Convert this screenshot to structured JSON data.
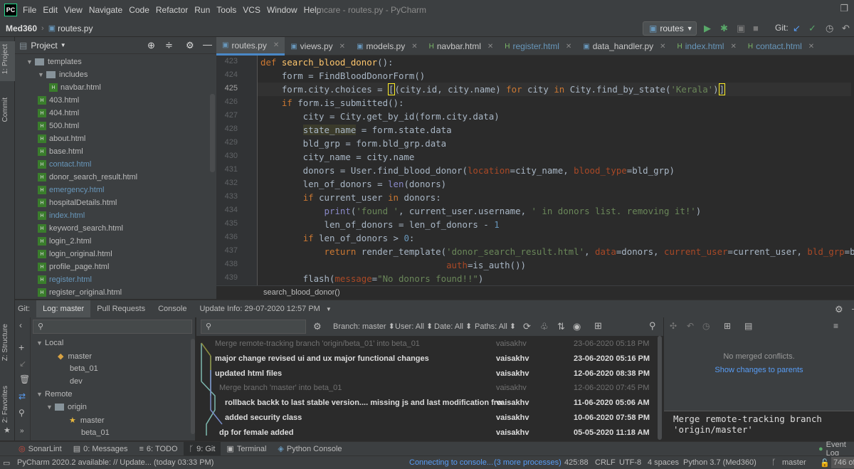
{
  "app": {
    "logo": "PC",
    "window_title": "mcare - routes.py - PyCharm",
    "menu": [
      "File",
      "Edit",
      "View",
      "Navigate",
      "Code",
      "Refactor",
      "Run",
      "Tools",
      "VCS",
      "Window",
      "Help"
    ]
  },
  "navbar": {
    "project": "Med360",
    "file": "routes.py",
    "run_config": "routes",
    "git_label": "Git:"
  },
  "left_strip": {
    "project_tab": "1: Project",
    "commit_tab": "Commit",
    "structure_tab": "Z: Structure",
    "favorites_tab": "2: Favorites"
  },
  "project": {
    "title": "Project",
    "tree": [
      {
        "label": "templates",
        "type": "folder",
        "depth": 0,
        "open": true
      },
      {
        "label": "includes",
        "type": "folder",
        "depth": 1,
        "open": true
      },
      {
        "label": "navbar.html",
        "type": "html",
        "depth": 2
      },
      {
        "label": "403.html",
        "type": "html",
        "depth": 1
      },
      {
        "label": "404.html",
        "type": "html",
        "depth": 1
      },
      {
        "label": "500.html",
        "type": "html",
        "depth": 1
      },
      {
        "label": "about.html",
        "type": "html",
        "depth": 1
      },
      {
        "label": "base.html",
        "type": "html",
        "depth": 1
      },
      {
        "label": "contact.html",
        "type": "html",
        "depth": 1,
        "modified": true
      },
      {
        "label": "donor_search_result.html",
        "type": "html",
        "depth": 1
      },
      {
        "label": "emergency.html",
        "type": "html",
        "depth": 1,
        "modified": true
      },
      {
        "label": "hospitalDetails.html",
        "type": "html",
        "depth": 1
      },
      {
        "label": "index.html",
        "type": "html",
        "depth": 1,
        "modified": true
      },
      {
        "label": "keyword_search.html",
        "type": "html",
        "depth": 1
      },
      {
        "label": "login_2.html",
        "type": "html",
        "depth": 1
      },
      {
        "label": "login_original.html",
        "type": "html",
        "depth": 1
      },
      {
        "label": "profile_page.html",
        "type": "html",
        "depth": 1
      },
      {
        "label": "register.html",
        "type": "html",
        "depth": 1,
        "modified": true
      },
      {
        "label": "register_original.html",
        "type": "html",
        "depth": 1
      }
    ]
  },
  "editor": {
    "tabs": [
      {
        "label": "routes.py",
        "active": true,
        "modified": false
      },
      {
        "label": "views.py",
        "active": false,
        "modified": false
      },
      {
        "label": "models.py",
        "active": false,
        "modified": false
      },
      {
        "label": "navbar.html",
        "active": false,
        "modified": false
      },
      {
        "label": "register.html",
        "active": false,
        "modified": true
      },
      {
        "label": "data_handler.py",
        "active": false,
        "modified": false
      },
      {
        "label": "index.html",
        "active": false,
        "modified": true
      },
      {
        "label": "contact.html",
        "active": false,
        "modified": true
      }
    ],
    "line_numbers": [
      "423",
      "424",
      "425",
      "426",
      "427",
      "428",
      "429",
      "430",
      "431",
      "432",
      "433",
      "434",
      "435",
      "436",
      "437",
      "438",
      "439"
    ],
    "current_line": "425",
    "breadcrumb": "search_blood_donor()"
  },
  "git": {
    "label": "Git:",
    "tabs": [
      "Log: master",
      "Pull Requests",
      "Console",
      "Update Info: 29-07-2020 12:57 PM"
    ],
    "branches": {
      "local_label": "Local",
      "local": [
        "master",
        "beta_01",
        "dev"
      ],
      "remote_label": "Remote",
      "origin": "origin",
      "remote": [
        "master",
        "beta_01"
      ]
    },
    "filters": {
      "branch": "Branch: master",
      "user": "User: All",
      "date": "Date: All",
      "paths": "Paths: All"
    },
    "commits": [
      {
        "message": "Merge remote-tracking branch 'origin/beta_01' into beta_01",
        "author": "vaisakhv",
        "date": "23-06-2020 05:18 PM",
        "dim": true
      },
      {
        "message": "major change revised ui and ux major functional changes",
        "author": "vaisakhv",
        "date": "23-06-2020 05:16 PM",
        "dim": false
      },
      {
        "message": "updated html files",
        "author": "vaisakhv",
        "date": "12-06-2020 08:38 PM",
        "dim": false
      },
      {
        "message": "Merge branch 'master' into beta_01",
        "author": "vaisakhv",
        "date": "12-06-2020 07:45 PM",
        "dim": true
      },
      {
        "message": "rollback backk to last stable version.... missing js and last modification from f",
        "author": "vaisakhv",
        "date": "11-06-2020 05:06 AM",
        "dim": false
      },
      {
        "message": "added security class",
        "author": "vaisakhv",
        "date": "10-06-2020 07:58 PM",
        "dim": false
      },
      {
        "message": "dp for female added",
        "author": "vaisakhv",
        "date": "05-05-2020 11:18 AM",
        "dim": false
      }
    ],
    "no_conflicts": "No merged conflicts.",
    "show_changes": "Show changes to parents",
    "commit_detail": "Merge remote-tracking branch 'origin/master'"
  },
  "tool_tabs": [
    {
      "label": "SonarLint",
      "prefix": ""
    },
    {
      "label": "0: Messages",
      "prefix": ""
    },
    {
      "label": "6: TODO",
      "prefix": ""
    },
    {
      "label": "9: Git",
      "prefix": ""
    },
    {
      "label": "Terminal",
      "prefix": ""
    },
    {
      "label": "Python Console",
      "prefix": ""
    }
  ],
  "event_log": "Event Log",
  "status": {
    "update_msg": "PyCharm 2020.2 available: // Update... (today 03:33 PM)",
    "connecting": "Connecting to console...",
    "processes": "(3 more processes)",
    "position": "425:88",
    "line_sep": "CRLF",
    "encoding": "UTF-8",
    "indent": "4 spaces",
    "interpreter": "Python 3.7 (Med360)",
    "branch": "master",
    "memory": "746 of"
  },
  "colors": {
    "accent": "#4a88c7",
    "keyword": "#cc7832",
    "function": "#ffc66d",
    "string": "#6a8759",
    "number": "#6897bb",
    "vcs_modified": "#6897bb"
  }
}
